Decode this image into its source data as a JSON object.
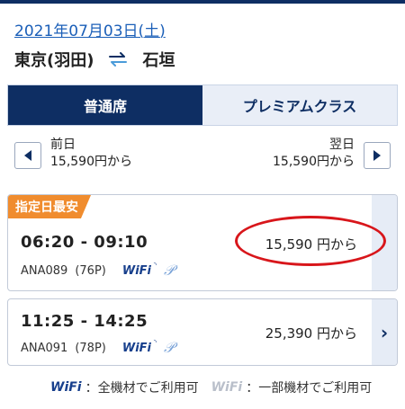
{
  "date": {
    "text": "2021年07月03日(",
    "weekday": "土",
    "close": ")"
  },
  "route": {
    "origin": "東京(羽田)",
    "destination": "石垣"
  },
  "tabs": [
    {
      "label": "普通席",
      "active": true
    },
    {
      "label": "プレミアムクラス",
      "active": false
    }
  ],
  "day_nav": {
    "prev_label": "前日",
    "prev_price": "15,590円から",
    "next_label": "翌日",
    "next_price": "15,590円から"
  },
  "flights": [
    {
      "badge": "指定日最安",
      "time": "06:20 - 09:10",
      "flight": "ANA089",
      "aircraft": "(76P)",
      "wifi": "WiFi",
      "price": "15,590 円から",
      "highlighted": true
    },
    {
      "badge": "",
      "time": "11:25 - 14:25",
      "flight": "ANA091",
      "aircraft": "(78P)",
      "wifi": "WiFi",
      "price": "25,390 円から",
      "highlighted": false
    }
  ],
  "legend": {
    "wifi_full": "WiFi",
    "full_text": "：全機材でご利用可",
    "wifi_partial": "WiFi",
    "partial_text": "：一部機材でご利用可"
  },
  "colors": {
    "navy": "#0e2e63",
    "link": "#1b5fb8",
    "badge": "#f08c2e",
    "highlight_ring": "#d8161b"
  },
  "icons": {
    "swap": "swap-arrows-icon",
    "prev": "triangle-left-icon",
    "next": "triangle-right-icon",
    "detail": "chevron-right-icon",
    "premium": "p-icon"
  }
}
